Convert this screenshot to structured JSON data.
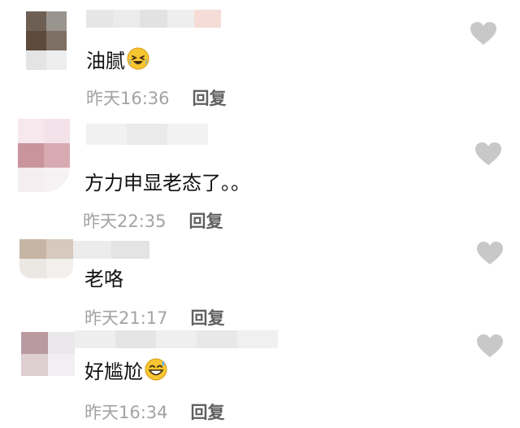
{
  "comments": [
    {
      "text": "油腻",
      "emoji": "laughing-crying-emoji",
      "time": "昨天16:36",
      "reply_label": "回复"
    },
    {
      "text": "方力申显老态了。。",
      "emoji": "",
      "time": "昨天22:35",
      "reply_label": "回复"
    },
    {
      "text": "老咯",
      "emoji": "",
      "time": "昨天21:17",
      "reply_label": "回复"
    },
    {
      "text": "好尴尬",
      "emoji": "grinning-sweat-emoji",
      "time": "昨天16:34",
      "reply_label": "回复"
    }
  ],
  "colors": {
    "like_icon": "#c8c8c8",
    "time_text": "#a3a3a3",
    "reply_text": "#606060",
    "emoji_yellow": "#f7c531"
  }
}
